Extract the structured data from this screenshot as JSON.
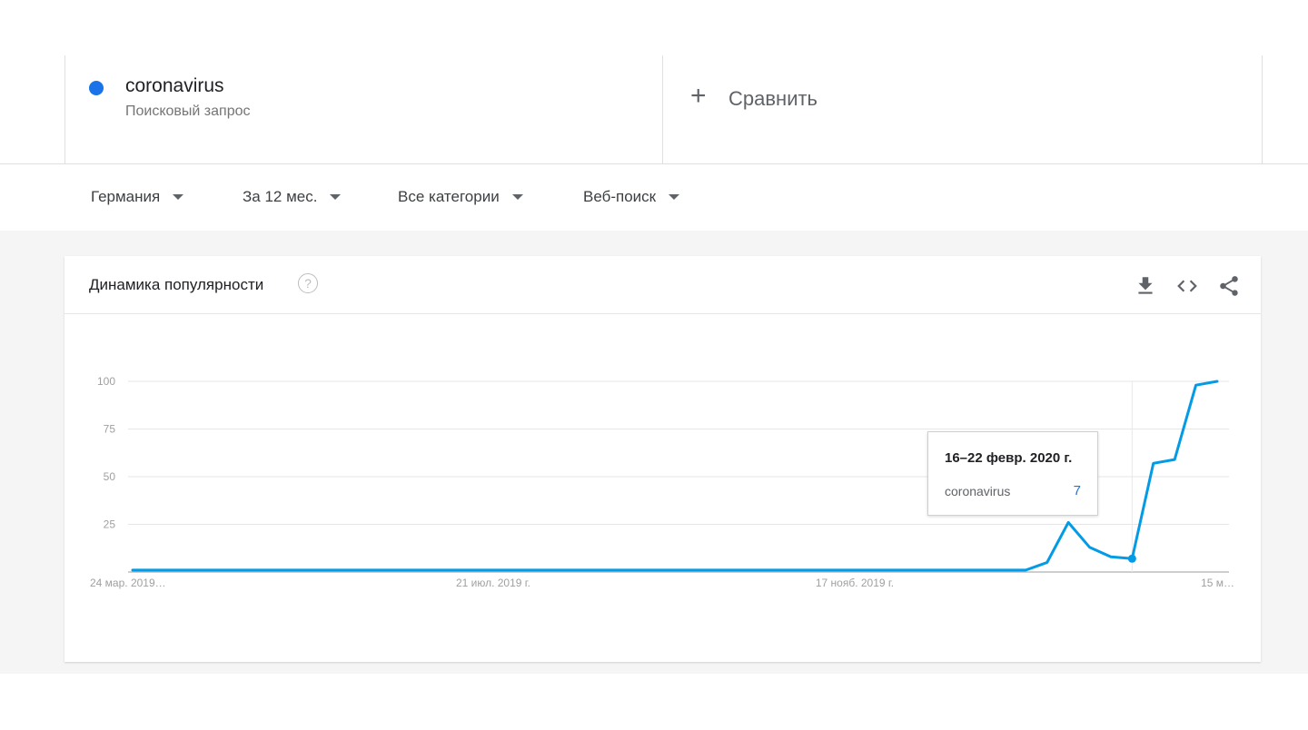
{
  "term": {
    "name": "coronavirus",
    "type": "Поисковый запрос",
    "color": "#1a73e8"
  },
  "compare": {
    "icon": "plus-icon",
    "label": "Сравнить"
  },
  "filters": [
    {
      "label": "Германия"
    },
    {
      "label": "За 12 мес."
    },
    {
      "label": "Все категории"
    },
    {
      "label": "Веб-поиск"
    }
  ],
  "card": {
    "title": "Динамика популярности",
    "help_icon": "?",
    "actions": [
      "download-icon",
      "embed-code-icon",
      "share-icon"
    ]
  },
  "tooltip": {
    "date": "16–22 февр. 2020 г.",
    "term": "coronavirus",
    "value": "7"
  },
  "chart_data": {
    "type": "line",
    "series_color": "#039be5",
    "ylim": [
      0,
      100
    ],
    "y_ticks": [
      "100",
      "75",
      "50",
      "25"
    ],
    "x_tick_labels": [
      "24 мар. 2019…",
      "21 июл. 2019 г.",
      "17 нояб. 2019 г.",
      "15 м…"
    ],
    "series": [
      {
        "name": "coronavirus",
        "values": [
          1,
          1,
          1,
          1,
          1,
          1,
          1,
          1,
          1,
          1,
          1,
          1,
          1,
          1,
          1,
          1,
          1,
          1,
          1,
          1,
          1,
          1,
          1,
          1,
          1,
          1,
          1,
          1,
          1,
          1,
          1,
          1,
          1,
          1,
          1,
          1,
          1,
          1,
          1,
          1,
          1,
          1,
          1,
          5,
          26,
          13,
          8,
          7,
          57,
          59,
          98,
          100
        ]
      }
    ],
    "highlight_index": 47
  }
}
